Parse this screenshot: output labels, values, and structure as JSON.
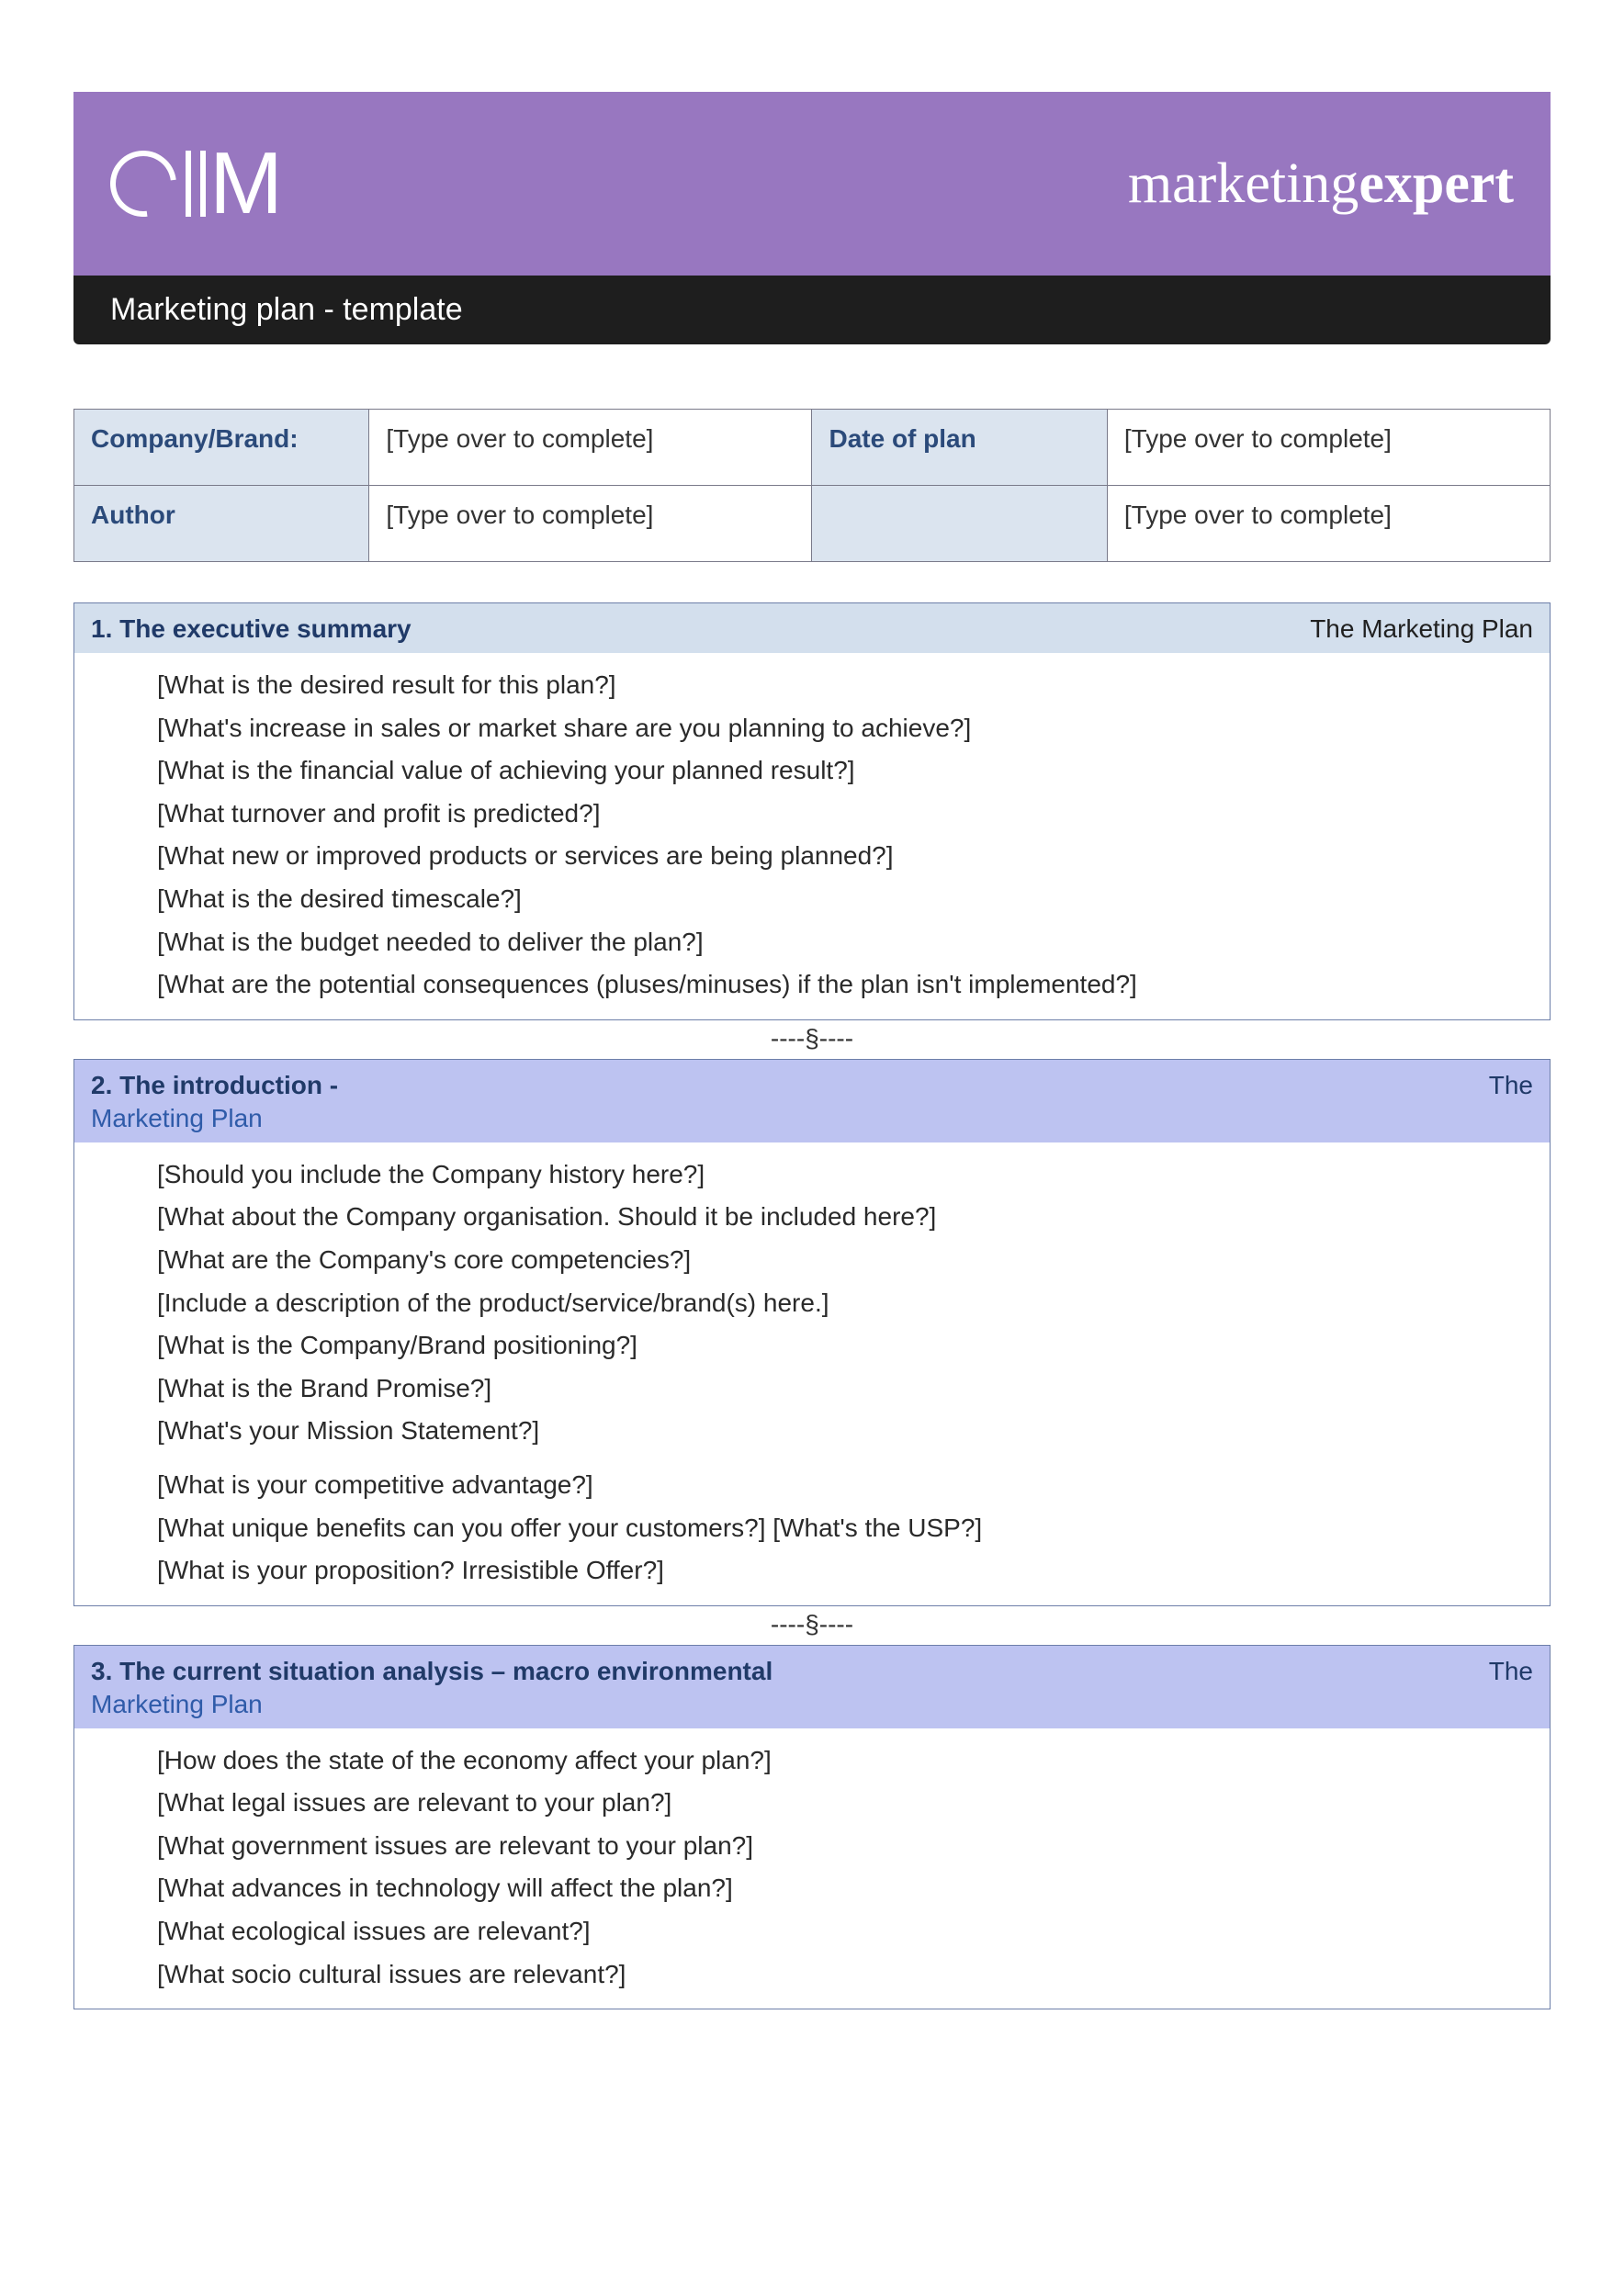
{
  "banner": {
    "logo_text": "CIM",
    "brand_left": "marketing",
    "brand_right": "expert"
  },
  "titlebar": "Marketing plan - template",
  "meta": {
    "rows": [
      {
        "label": "Company/Brand:",
        "value": "[Type over to complete]",
        "label2": "Date of plan",
        "value2": "[Type over to complete]"
      },
      {
        "label": "Author",
        "value": "[Type over to complete]",
        "label2": "",
        "value2": "[Type over to complete]"
      }
    ]
  },
  "sections": [
    {
      "num_title": "1.  The executive summary",
      "right": "The Marketing Plan",
      "questions": [
        "[What is the desired result for this plan?]",
        "[What's increase in sales or market share are you planning to achieve?]",
        "[What is the financial value of achieving your planned result?]",
        "[What turnover and profit is predicted?]",
        "[What new or improved products or services are being planned?]",
        "[What is the desired timescale?]",
        "[What is the budget needed to deliver the plan?]",
        "[What are the potential consequences (pluses/minuses) if the plan isn't implemented?]"
      ]
    },
    {
      "num_title": "2.  The introduction -",
      "right": "The",
      "subline": "Marketing Plan",
      "questions_a": [
        "[Should you include the Company history here?]",
        "[What about the Company organisation.  Should it be included here?]",
        "[What are the Company's core competencies?]",
        "[Include a description of the product/service/brand(s) here.]",
        "[What is the Company/Brand positioning?]",
        "[What is the Brand Promise?]",
        "[What's your Mission Statement?]"
      ],
      "questions_b": [
        "[What is your competitive advantage?]",
        "[What unique benefits can you offer your customers?]  [What's the USP?]",
        "[What is your proposition? Irresistible Offer?]"
      ]
    },
    {
      "num_title": "3. The current situation analysis – macro environmental",
      "right": "The",
      "subline": "Marketing Plan",
      "questions": [
        "[How does the state of the economy affect your plan?]",
        "[What legal issues are relevant to your plan?]",
        "[What government issues are relevant to your plan?]",
        "[What advances in technology will affect the plan?]",
        "[What ecological issues are relevant?]",
        "[What socio cultural issues are relevant?]"
      ]
    }
  ],
  "separator": "----§----"
}
